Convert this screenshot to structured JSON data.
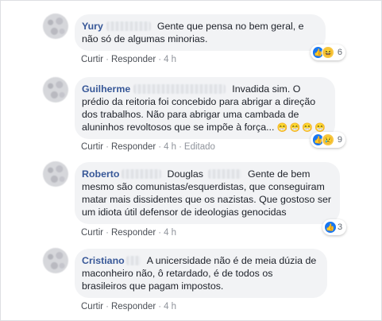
{
  "comments": [
    {
      "author": "Yury",
      "mention": "",
      "text": "Gente que pensa no bem geral, e não só de algumas minorias.",
      "emoji": "",
      "actions": {
        "like": "Curtir",
        "reply": "Responder",
        "time": "4 h",
        "edited": ""
      },
      "reactions": {
        "icons": [
          "like-icon",
          "haha-icon"
        ],
        "count": "6"
      }
    },
    {
      "author": "Guilherme",
      "mention": "",
      "text": "Invadida sim. O prédio da reitoria foi concebido para abrigar a direção dos trabalhos. Não para abrigar uma cambada de aluninhos revoltosos que se impõe à força...",
      "emoji": "😁😁😁😁",
      "actions": {
        "like": "Curtir",
        "reply": "Responder",
        "time": "4 h",
        "edited": "Editado"
      },
      "reactions": {
        "icons": [
          "like-icon",
          "sad-icon"
        ],
        "count": "9"
      }
    },
    {
      "author": "Roberto",
      "mention": "Douglas",
      "text": "Gente de bem mesmo são comunistas/esquerdistas, que conseguiram matar mais dissidentes que os nazistas. Que gostoso ser um idiota útil defensor de ideologias genocidas",
      "emoji": "",
      "actions": {
        "like": "Curtir",
        "reply": "Responder",
        "time": "4 h",
        "edited": ""
      },
      "reactions": {
        "icons": [
          "like-icon"
        ],
        "count": "3"
      }
    },
    {
      "author": "Cristiano",
      "mention": "",
      "text": "A unicersidade não é de meia dúzia de maconheiro não, ô retardado, é de todos os brasileiros que pagam impostos.",
      "emoji": "",
      "actions": {
        "like": "Curtir",
        "reply": "Responder",
        "time": "4 h",
        "edited": ""
      },
      "reactions": null
    }
  ],
  "colors": {
    "author": "#385898",
    "bubble": "#f2f3f5",
    "like": "#1877f2",
    "meta": "#606770"
  }
}
